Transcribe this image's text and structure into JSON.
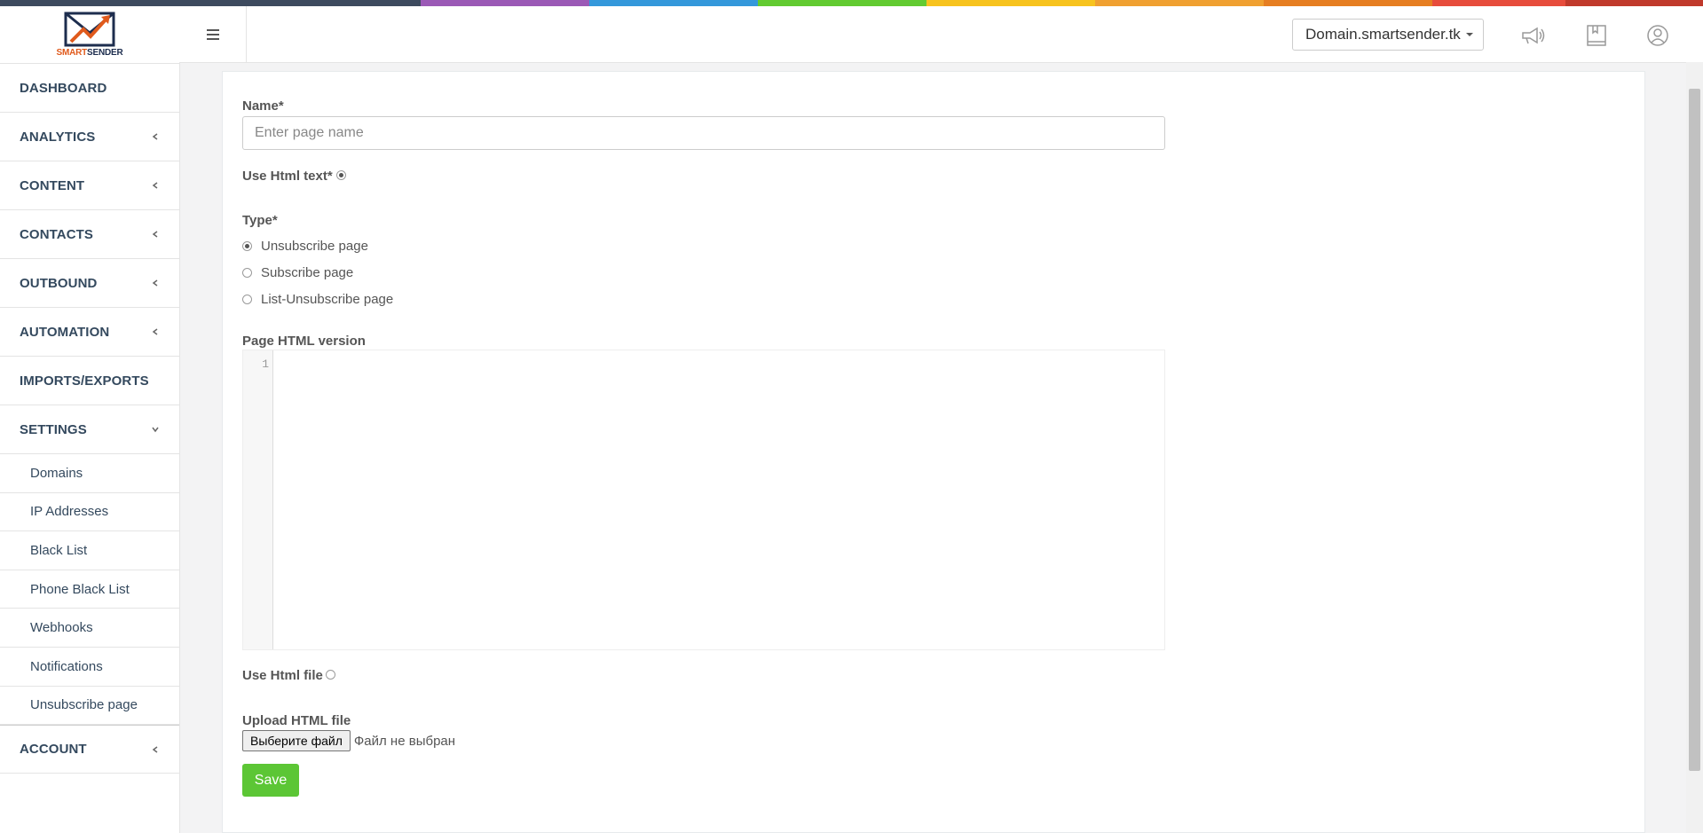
{
  "top_strip_colors": [
    "#3d4a5e",
    "#9b59b6",
    "#3498db",
    "#62cb31",
    "#f7c31e",
    "#f0a030",
    "#e67e22",
    "#e74c3c",
    "#c0392b"
  ],
  "logo": {
    "text_part1": "SMART",
    "text_part2": "SENDER",
    "color_primary": "#e05a1c",
    "color_secondary": "#1d2d4e"
  },
  "sidebar": {
    "items": [
      {
        "label": "DASHBOARD",
        "has_chevron": false
      },
      {
        "label": "ANALYTICS",
        "has_chevron": true
      },
      {
        "label": "CONTENT",
        "has_chevron": true
      },
      {
        "label": "CONTACTS",
        "has_chevron": true
      },
      {
        "label": "OUTBOUND",
        "has_chevron": true
      },
      {
        "label": "AUTOMATION",
        "has_chevron": true
      },
      {
        "label": "IMPORTS/EXPORTS",
        "has_chevron": false
      },
      {
        "label": "SETTINGS",
        "has_chevron": true,
        "expanded": true
      }
    ],
    "settings_subitems": [
      "Domains",
      "IP Addresses",
      "Black List",
      "Phone Black List",
      "Webhooks",
      "Notifications",
      "Unsubscribe page"
    ],
    "account_label": "ACCOUNT"
  },
  "header": {
    "menu_icon": "hamburger-icon",
    "domain_selector": "Domain.smartsender.tk",
    "icons": [
      "megaphone-icon",
      "book-icon",
      "user-icon"
    ]
  },
  "form": {
    "name_label": "Name*",
    "name_placeholder": "Enter page name",
    "name_value": "",
    "use_html_text_label": "Use Html text*",
    "use_html_text_checked": true,
    "type_label": "Type*",
    "type_options": [
      {
        "label": "Unsubscribe page",
        "checked": true
      },
      {
        "label": "Subscribe page",
        "checked": false
      },
      {
        "label": "List-Unsubscribe page",
        "checked": false
      }
    ],
    "html_version_label": "Page HTML version",
    "editor_line_number": "1",
    "use_html_file_label": "Use Html file",
    "use_html_file_checked": false,
    "upload_label": "Upload HTML file",
    "file_button_label": "Выберите файл",
    "file_status": "Файл не выбран",
    "save_label": "Save",
    "save_color": "#5cc635"
  }
}
